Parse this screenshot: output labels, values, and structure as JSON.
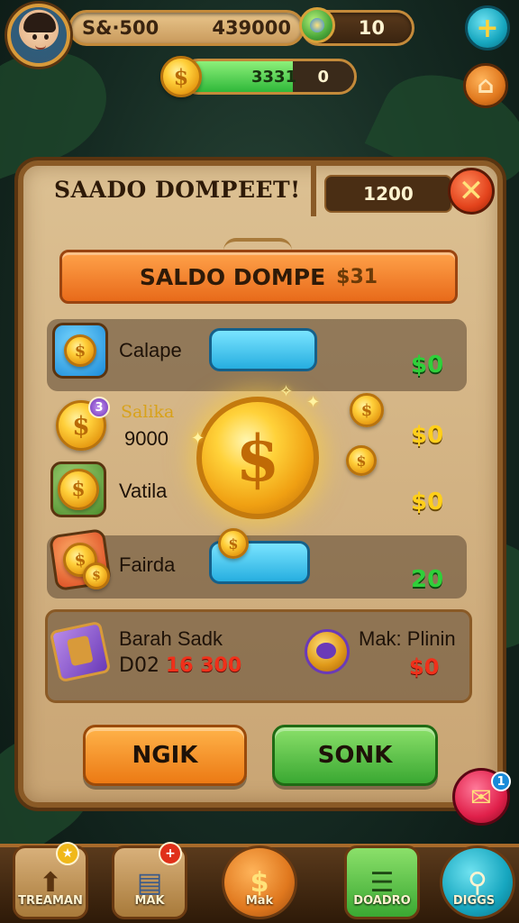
{
  "hud": {
    "primary_left": "S&·500",
    "primary_right": "439000",
    "gem_value": "10",
    "energy_value": "3331",
    "energy_level": 0.64,
    "energy_secondary": "0"
  },
  "panel": {
    "title": "SAADO DOMPEET!",
    "title_amount": "1200",
    "banner_label": "SALDO DOMPE",
    "banner_value": "$31",
    "rows": [
      {
        "label": "Calape",
        "value": "$0"
      },
      {
        "label": "Salika",
        "sub": "9000",
        "badge": "3",
        "value": "$0"
      },
      {
        "label": "Vatila",
        "value": "$0"
      },
      {
        "label": "Fairda",
        "value": "20"
      }
    ],
    "info": {
      "left_title": "Barah Sadk",
      "left_prefix": "D02",
      "left_value": "16 300",
      "right_title": "Mak: Plinin",
      "right_value": "$0"
    },
    "buttons": {
      "left": "NGIK",
      "right": "SONK"
    }
  },
  "mail_badge": "1",
  "nav": [
    {
      "label": "TREAMAN",
      "icon": "map-icon"
    },
    {
      "label": "MAK",
      "icon": "cards-icon"
    },
    {
      "label": "Mak",
      "icon": "coin-icon"
    },
    {
      "label": "DOADRO",
      "icon": "list-icon"
    },
    {
      "label": "DIGGS",
      "icon": "magnifier-icon"
    }
  ],
  "colors": {
    "panel": "#c9a574",
    "orange_banner": "#e86a1a",
    "green_value": "#2fd03a",
    "yellow_value": "#ffcf1a",
    "red_value": "#f0301a"
  }
}
